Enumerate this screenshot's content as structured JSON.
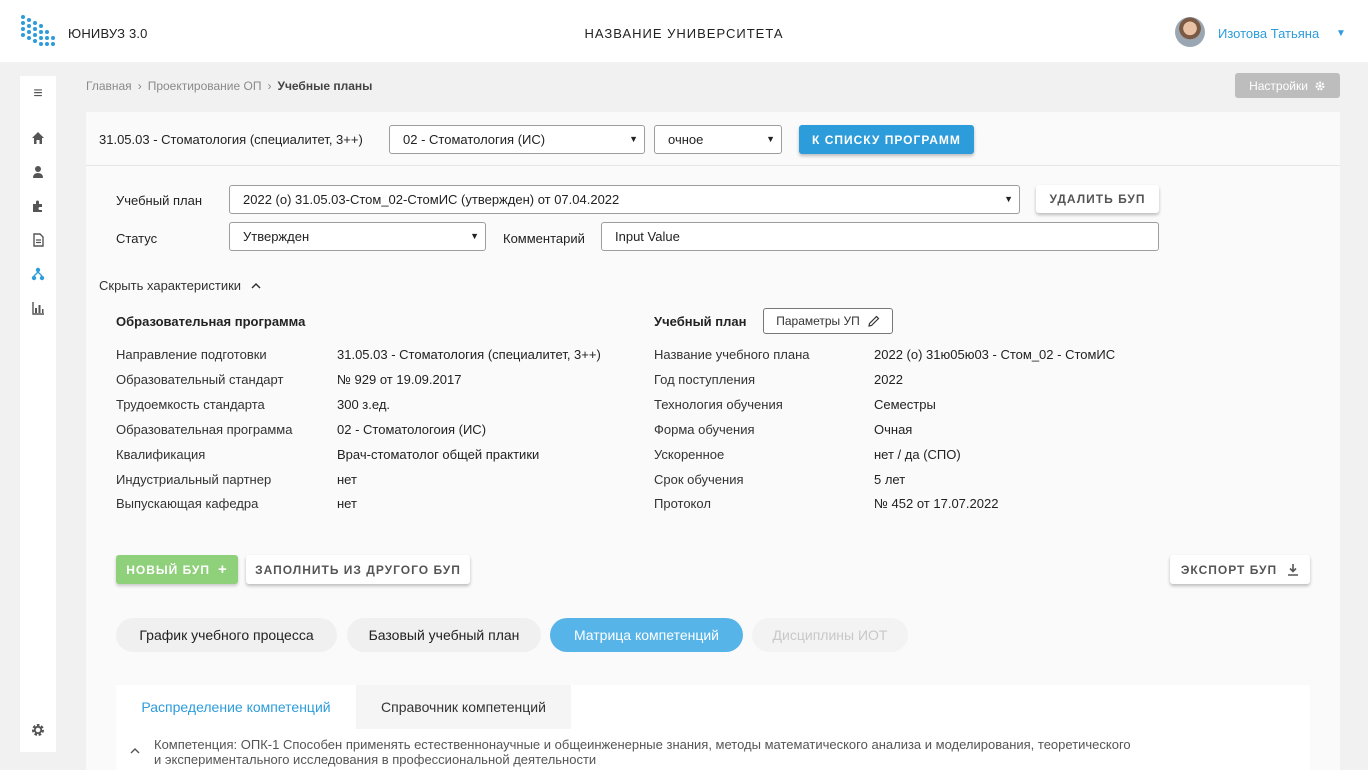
{
  "header": {
    "app_name": "ЮНИВУЗ 3.0",
    "university": "НАЗВАНИЕ УНИВЕРСИТЕТА",
    "user": "Изотова Татьяна",
    "brand_color": "#2d9cdb"
  },
  "breadcrumbs": {
    "home": "Главная",
    "section": "Проектирование ОП",
    "current": "Учебные планы"
  },
  "settings_label": "Настройки",
  "program": {
    "title": "31.05.03 - Стоматология (специалитет, 3++)",
    "profile_select": "02 - Стоматология (ИС)",
    "form_select": "очное",
    "back_button": "К СПИСКУ ПРОГРАММ"
  },
  "plan_form": {
    "plan_label": "Учебный план",
    "plan_value": "2022 (о) 31.05.03-Стом_02-СтомИС (утвержден) от 07.04.2022",
    "delete_button": "УДАЛИТЬ БУП",
    "status_label": "Статус",
    "status_value": "Утвержден",
    "comment_label": "Комментарий",
    "comment_value": "Input Value"
  },
  "toggle_label": "Скрыть характеристики",
  "edu_program": {
    "title": "Образовательная программа",
    "rows": [
      {
        "k": "Направление подготовки",
        "v": "31.05.03 - Стоматология (специалитет, 3++)"
      },
      {
        "k": "Образовательный стандарт",
        "v": "№ 929 от 19.09.2017"
      },
      {
        "k": "Трудоемкость стандарта",
        "v": "300 з.ед."
      },
      {
        "k": "Образовательная программа",
        "v": "02 - Стоматологоия (ИС)"
      },
      {
        "k": "Квалификация",
        "v": "Врач-стоматолог общей практики"
      },
      {
        "k": "Индустриальный партнер",
        "v": "нет"
      },
      {
        "k": "Выпускающая кафедра",
        "v": "нет"
      }
    ]
  },
  "study_plan": {
    "title": "Учебный план",
    "params_button": "Параметры УП",
    "rows": [
      {
        "k": "Название учебного плана",
        "v": "2022 (о) 31ю05ю03 - Стом_02 - СтомИС"
      },
      {
        "k": "Год поступления",
        "v": "2022"
      },
      {
        "k": "Технология обучения",
        "v": "Семестры"
      },
      {
        "k": "Форма обучения",
        "v": "Очная"
      },
      {
        "k": "Ускоренное",
        "v": "нет / да (СПО)"
      },
      {
        "k": "Срок обучения",
        "v": "5 лет"
      },
      {
        "k": "Протокол",
        "v": "№ 452 от 17.07.2022"
      }
    ]
  },
  "actions": {
    "new_plan": "НОВЫЙ БУП",
    "fill_from": "ЗАПОЛНИТЬ ИЗ ДРУГОГО БУП",
    "export": "ЭКСПОРТ БУП"
  },
  "tabs": [
    {
      "label": "График учебного процесса",
      "state": "normal"
    },
    {
      "label": "Базовый учебный план",
      "state": "normal"
    },
    {
      "label": "Матрица компетенций",
      "state": "active"
    },
    {
      "label": "Дисциплины ИОТ",
      "state": "disabled"
    }
  ],
  "subtabs": {
    "active": "Распределение компетенций",
    "other": "Справочник компетенций"
  },
  "competence": {
    "line1": "Компетенция: ОПК-1 Способен применять естественнонаучные и общеинженерные знания, методы математического анализа и моделирования, теоретического",
    "line2": "и экспериментального исследования в профессиональной деятельности"
  }
}
